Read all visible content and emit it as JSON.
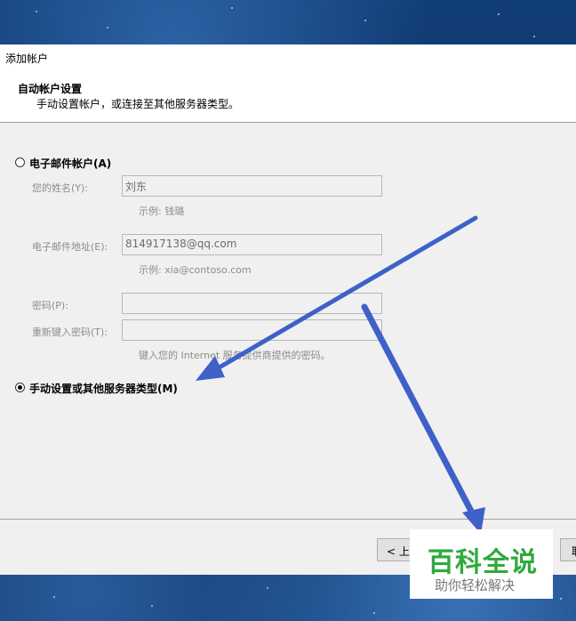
{
  "window": {
    "title": "添加帐户"
  },
  "header": {
    "title": "自动帐户设置",
    "subtitle": "手动设置帐户，或连接至其他服务器类型。"
  },
  "email_option": {
    "label": "电子邮件帐户(A)",
    "selected": false,
    "name_label": "您的姓名(Y):",
    "name_value": "刘东",
    "name_hint": "示例: 钱璐",
    "email_label": "电子邮件地址(E):",
    "email_value": "814917138@qq.com",
    "email_hint": "示例: xia@contoso.com",
    "password_label": "密码(P):",
    "password_value": "",
    "retype_label": "重新键入密码(T):",
    "retype_value": "",
    "password_hint": "键入您的 Internet 服务提供商提供的密码。"
  },
  "manual_option": {
    "label": "手动设置或其他服务器类型(M)",
    "selected": true
  },
  "footer": {
    "back_button": "< 上一步",
    "cancel_button": "取"
  },
  "watermark": {
    "brand": "百科全说",
    "tagline": "助你轻松解决"
  },
  "colors": {
    "arrow": "#3e61c9",
    "watermark_green": "#2eaa3c",
    "dialog_bg": "#f0f0f0"
  }
}
